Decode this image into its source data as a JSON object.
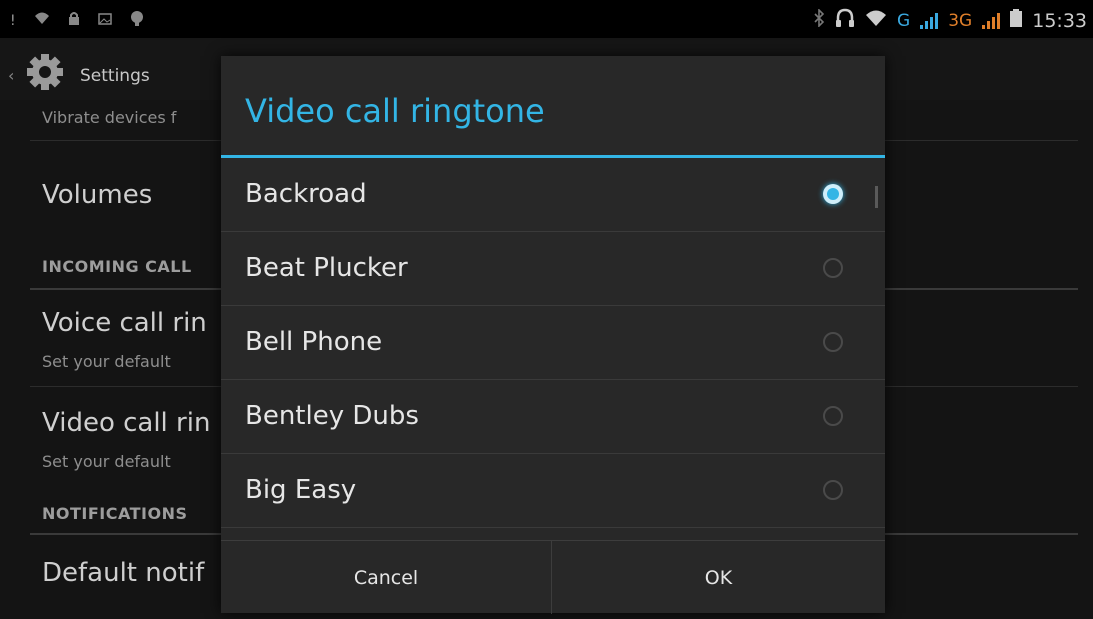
{
  "status_bar": {
    "left_icons": [
      "alert-icon",
      "wifi-icon",
      "lock-icon",
      "image-icon",
      "app-icon"
    ],
    "g_label": "G",
    "threeg_label": "3G",
    "time": "15:33"
  },
  "action_bar": {
    "back": "‹",
    "title": "Settings"
  },
  "settings": {
    "truncated_sub": "Vibrate devices f",
    "volumes": "Volumes",
    "incoming_header": "INCOMING CALL",
    "voice_title": "Voice call rin",
    "voice_sub": "Set your default",
    "video_title": "Video call rin",
    "video_sub": "Set your default",
    "notifications_header": "NOTIFICATIONS",
    "default_notif": "Default notif"
  },
  "dialog": {
    "title": "Video call ringtone",
    "options": [
      {
        "label": "Backroad",
        "selected": true
      },
      {
        "label": "Beat Plucker",
        "selected": false
      },
      {
        "label": "Bell Phone",
        "selected": false
      },
      {
        "label": "Bentley Dubs",
        "selected": false
      },
      {
        "label": "Big Easy",
        "selected": false
      }
    ],
    "cancel": "Cancel",
    "ok": "OK"
  },
  "colors": {
    "accent": "#33b5e5",
    "g_signal": "#3aa9e0",
    "threeg_signal": "#e07f2a"
  }
}
